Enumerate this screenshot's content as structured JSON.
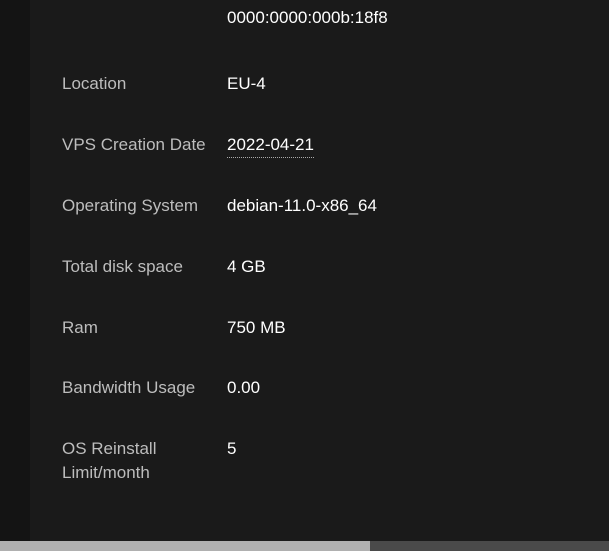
{
  "topValue": "0000:0000:000b:18f8",
  "rows": [
    {
      "label": "Location",
      "value": "EU-4",
      "dotted": false
    },
    {
      "label": "VPS Creation Date",
      "value": "2022-04-21",
      "dotted": true
    },
    {
      "label": "Operating System",
      "value": "debian-11.0-x86_64",
      "dotted": false
    },
    {
      "label": "Total disk space",
      "value": "4 GB",
      "dotted": false
    },
    {
      "label": "Ram",
      "value": "750 MB",
      "dotted": false
    },
    {
      "label": "Bandwidth Usage",
      "value": "0.00",
      "dotted": false
    },
    {
      "label": "OS Reinstall Limit/month",
      "value": "5",
      "dotted": false
    }
  ]
}
